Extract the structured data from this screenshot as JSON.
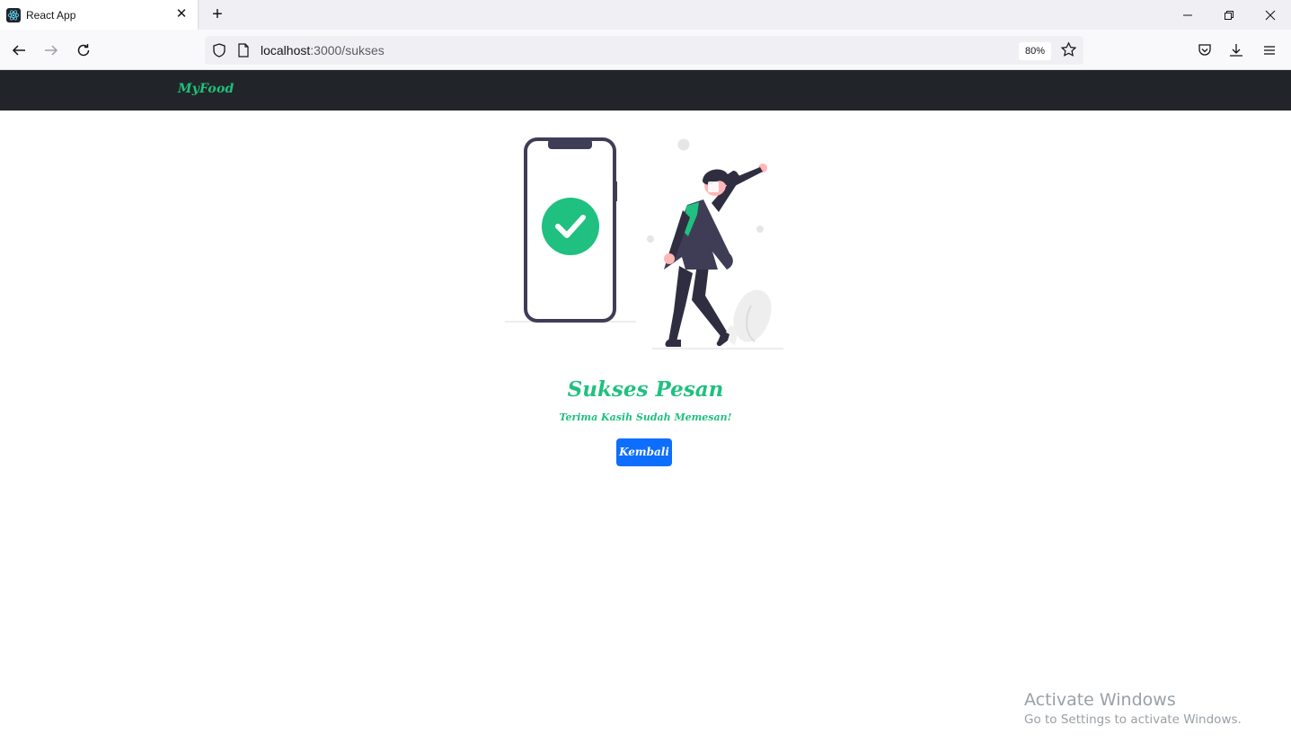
{
  "browser": {
    "tab_title": "React App",
    "url_host": "localhost",
    "url_path": ":3000/sukses",
    "zoom": "80%"
  },
  "app": {
    "brand": "MyFood"
  },
  "main": {
    "title": "Sukses Pesan",
    "subtitle": "Terima Kasih Sudah Memesan!",
    "back_button": "Kembali"
  },
  "watermark": {
    "line1": "Activate Windows",
    "line2": "Go to Settings to activate Windows."
  },
  "colors": {
    "navbar": "#212529",
    "accent_green": "#20c080",
    "button_blue": "#0d6efd"
  }
}
